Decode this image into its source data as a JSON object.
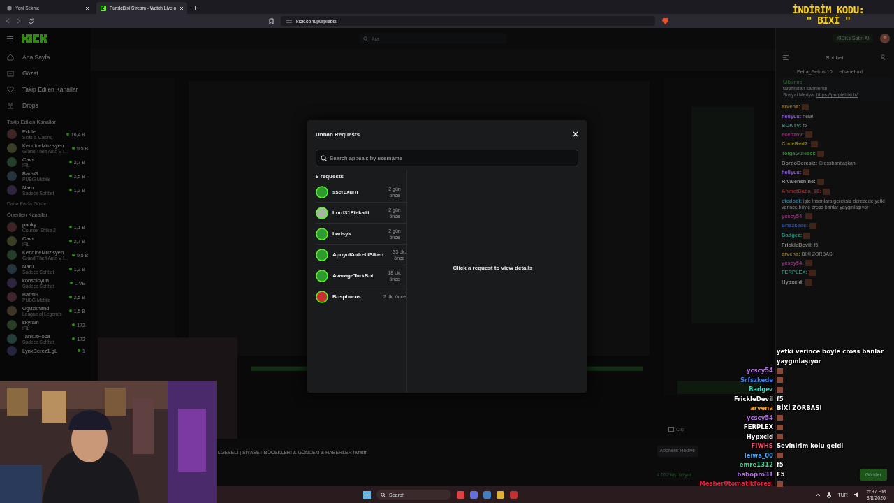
{
  "browser": {
    "tabs": [
      {
        "title": "Yeni Sekme",
        "selected": false
      },
      {
        "title": "PurpleBixi Stream - Watch Live o",
        "selected": true
      }
    ],
    "url": "kick.com/purplebixi"
  },
  "promo": {
    "lines": [
      "İNDİRİM KODU:",
      "\" BİXİ \""
    ]
  },
  "header": {
    "search_placeholder": "Ara",
    "buy_button": "KICKs Satın Al"
  },
  "sidebar": {
    "nav": [
      {
        "label": "Ana Sayfa"
      },
      {
        "label": "Gözat"
      },
      {
        "label": "Takip Edilen Kanallar"
      },
      {
        "label": "Drops"
      }
    ],
    "sections": [
      {
        "title": "Takip Edilen Kanallar",
        "more": "Daha Fazla Göster",
        "channels": [
          {
            "name": "Eddie",
            "category": "Slots & Casino",
            "viewers": "16,4 B"
          },
          {
            "name": "KendineMuzisyen",
            "category": "Grand Theft Auto V I...",
            "viewers": "9,5 B"
          },
          {
            "name": "Cavs",
            "category": "IRL",
            "viewers": "2,7 B"
          },
          {
            "name": "BarisG",
            "category": "PUBG Mobile",
            "viewers": "2,5 B"
          },
          {
            "name": "Naru",
            "category": "Sadece Sohbet",
            "viewers": "1,3 B"
          }
        ]
      },
      {
        "title": "Önerilen Kanallar",
        "channels": [
          {
            "name": "panky",
            "category": "Counter-Strike 2",
            "viewers": "1,1 B"
          },
          {
            "name": "Cavs",
            "category": "IRL",
            "viewers": "2,7 B"
          },
          {
            "name": "KendineMuzisyen",
            "category": "Grand Theft Auto V I...",
            "viewers": "9,5 B"
          },
          {
            "name": "Naru",
            "category": "Sadece Sohbet",
            "viewers": "1,3 B"
          },
          {
            "name": "konsoloyun",
            "category": "Sadece Sohbet",
            "viewers": "LIVE"
          },
          {
            "name": "BarisG",
            "category": "PUBG Mobile",
            "viewers": "2,5 B"
          },
          {
            "name": "Oguzkhand",
            "category": "League of Legends",
            "viewers": "1,5 B"
          },
          {
            "name": "skyrairi",
            "category": "IRL",
            "viewers": "172"
          },
          {
            "name": "TankutHoca",
            "category": "Sadece Sohbet",
            "viewers": "172"
          },
          {
            "name": "LynxCerez1.gL",
            "viewers": "1"
          }
        ]
      }
    ]
  },
  "stream": {
    "title": "LGESELİ | SİYASET BÖCEKLERİ & GÜNDEM & HABERLER !wraith",
    "viewers": "4.552 kişi izliyor",
    "clip_button": "Clip",
    "gift_button": "Abonelik Hediye"
  },
  "modal": {
    "title": "Unban Requests",
    "search_placeholder": "Search appeals by username",
    "count": "6 requests",
    "empty_text": "Click a request to view details",
    "requests": [
      {
        "username": "ssercxurn",
        "time": "2 gün önce",
        "color": "#2f9a2f",
        "selected": false
      },
      {
        "username": "Lord31Etekalti",
        "time": "2 gün önce",
        "color": "#a8b8a0",
        "selected": false
      },
      {
        "username": "barisyk",
        "time": "2 gün önce",
        "color": "#2f9a2f",
        "selected": false
      },
      {
        "username": "ApoyuKudretliSiken",
        "time": "33 dk. önce",
        "color": "#2f9a2f",
        "selected": false
      },
      {
        "username": "AvarageTurkBoi",
        "time": "18 dk. önce",
        "color": "#2f9a2f",
        "selected": false
      },
      {
        "username": "Bosphoros",
        "time": "2 dk. önce",
        "color": "#c83030",
        "selected": false
      }
    ]
  },
  "chat": {
    "title": "Sohbet",
    "chips": [
      {
        "name": "Petra_Petrus",
        "count": "10"
      },
      {
        "name": "efsanehoki"
      }
    ],
    "pinned": {
      "user": "Ulkuimre",
      "note": "tarafından sabitlendi",
      "label": "Sosyal Medya:",
      "link": "https://purplebixi.tr/"
    },
    "messages": [
      {
        "user": "arvena:",
        "color": "#8a6e2a",
        "emote": true
      },
      {
        "user": "heliyus:",
        "color": "#9060d8",
        "text": "helal",
        "emote": false
      },
      {
        "user": "BOKTV:",
        "color": "#2a8a7a",
        "text": "f5",
        "emote": false
      },
      {
        "user": "ecenznv:",
        "color": "#8a3474",
        "emote": true
      },
      {
        "user": "CodeRed7:",
        "color": "#7e7e1c",
        "emote": true
      },
      {
        "user": "TolgaGulesci:",
        "color": "#328432",
        "emote": true
      },
      {
        "user": "BordoBeresiz:",
        "color": "#7a7a7a",
        "text": "Crossbanbaşkanı",
        "emote": false
      },
      {
        "user": "heliyus:",
        "color": "#9060d8",
        "emote": true
      },
      {
        "user": "Rivalenshine:",
        "color": "#8e8e8e",
        "emote": true
      },
      {
        "user": "AhmetBaba_18:",
        "color": "#8a2c2c",
        "emote": true
      },
      {
        "user": "efedodi:",
        "color": "#327a96",
        "text": "işte insanlara gereksiz derecede yetki verince böyle cross banlar yaygınlaşıyor",
        "emote": false
      },
      {
        "user": "ycscy54:",
        "color": "#8a3474",
        "emote": true
      },
      {
        "user": "Srfszkede:",
        "color": "#324e90",
        "emote": true
      },
      {
        "user": "Badgez:",
        "color": "#2a8a7a",
        "emote": true
      },
      {
        "user": "FrickleDevil:",
        "color": "#848484",
        "text": "f5",
        "emote": false
      },
      {
        "user": "arvena:",
        "color": "#8a6e2a",
        "text": "BİXİ ZORBASI",
        "emote": false
      },
      {
        "user": "ycscy54:",
        "color": "#8a3474",
        "emote": true
      },
      {
        "user": "FERPLEX:",
        "color": "#2a8a7a",
        "emote": true
      },
      {
        "user": "Hypxcid:",
        "color": "#8e8e8e",
        "emote": true
      }
    ],
    "send_button": "Gönder"
  },
  "overlay_chat": [
    {
      "text": "yetki verince böyle cross banlar",
      "emote": false
    },
    {
      "text": "yaygınlaşıyor",
      "emote": false
    },
    {
      "user": "ycscy54",
      "color": "#b070e0",
      "emote": true
    },
    {
      "user": "Srfszkede",
      "color": "#3c7ce8",
      "emote": true
    },
    {
      "user": "Badgez",
      "color": "#30d8c0",
      "emote": true
    },
    {
      "user": "FrickleDevil",
      "color": "#ffffff",
      "text": "f5",
      "emote": false
    },
    {
      "user": "arvena",
      "color": "#f0a020",
      "text": "BİXİ ZORBASI",
      "emote": false
    },
    {
      "user": "ycscy54",
      "color": "#b070e0",
      "emote": true
    },
    {
      "user": "FERPLEX",
      "color": "#ffffff",
      "emote": true
    },
    {
      "user": "Hypxcid",
      "color": "#ffffff",
      "emote": true
    },
    {
      "user": "FIWHS",
      "color": "#f05070",
      "text": "Sevinirim kolu geldi",
      "emote": false
    },
    {
      "user": "leiwa_00",
      "color": "#50a8f0",
      "emote": true
    },
    {
      "user": "emre1312",
      "color": "#40d890",
      "text": "f5",
      "emote": false
    },
    {
      "user": "babopro31",
      "color": "#b070e0",
      "text": "F5",
      "emote": false
    },
    {
      "user": "Mesher0tomatikforesi",
      "color": "#e02040",
      "emote": true
    }
  ],
  "taskbar": {
    "search_placeholder": "Search",
    "language": "TUR",
    "time": "5:37 PM",
    "date": "8/8/2026"
  }
}
